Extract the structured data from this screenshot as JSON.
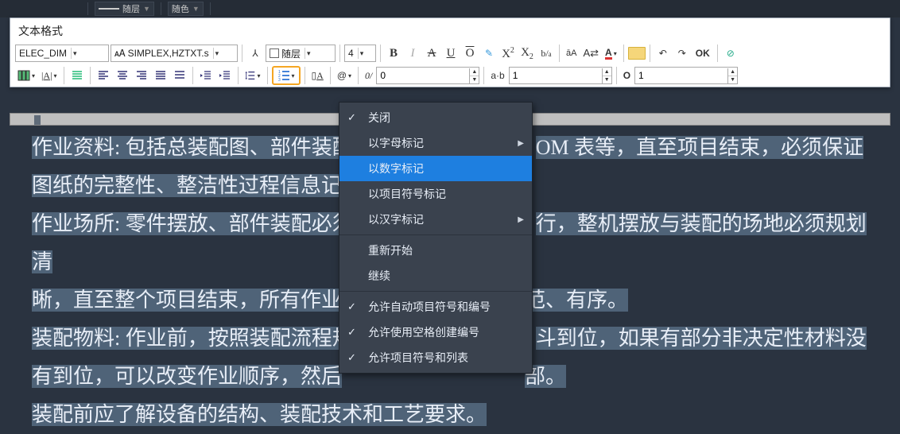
{
  "topstrip": {
    "combo1": "随层",
    "combo2": "随色"
  },
  "panel_title": "文本格式",
  "row1": {
    "style_name": "ELEC_DIM",
    "font_name": "SIMPLEX,HZTXT.s",
    "color_layer": "随层",
    "font_size": "4",
    "ok_label": "OK"
  },
  "row2": {
    "num1": "0",
    "ab_label": "a·b",
    "num2": "1",
    "o_label": "O",
    "num3": "1"
  },
  "menu": {
    "items": [
      {
        "label": "关闭",
        "checked": true,
        "submenu": false,
        "sel": false
      },
      {
        "label": "以字母标记",
        "checked": false,
        "submenu": true,
        "sel": false
      },
      {
        "label": "以数字标记",
        "checked": false,
        "submenu": false,
        "sel": true
      },
      {
        "label": "以项目符号标记",
        "checked": false,
        "submenu": false,
        "sel": false
      },
      {
        "label": "以汉字标记",
        "checked": false,
        "submenu": true,
        "sel": false
      }
    ],
    "group2": [
      {
        "label": "重新开始"
      },
      {
        "label": "继续"
      }
    ],
    "group3": [
      {
        "label": "允许自动项目符号和编号",
        "checked": true
      },
      {
        "label": "允许使用空格创建编号",
        "checked": true
      },
      {
        "label": "允许项目符号和列表",
        "checked": true
      }
    ]
  },
  "document": {
    "l1a": "作业资料: 包括总装配图、部件装配",
    "l1b": "OM 表等，直至项目结束，必须保证",
    "l2": "图纸的完整性、整洁性过程信息记录",
    "l3a": "作业场所: 零件摆放、部件装配必须",
    "l3b": "行，整机摆放与装配的场地必须规划清",
    "l4a": "晰，直至整个项目结束，所有作业",
    "l4b": "范、有序。",
    "l5a": "装配物料: 作业前，按照装配流程规",
    "l5b": "斗到位，如果有部分非决定性材料没",
    "l6a": "有到位，可以改变作业顺序，然后",
    "l6b": "部。",
    "l7": "装配前应了解设备的结构、装配技术和工艺要求。"
  }
}
